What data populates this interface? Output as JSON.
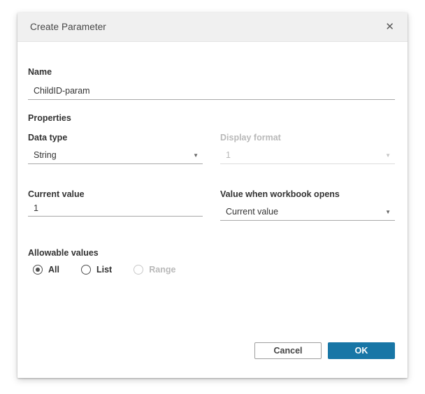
{
  "dialog": {
    "title": "Create Parameter"
  },
  "icons": {
    "close": "✕",
    "dropdown_arrow": "▼"
  },
  "fields": {
    "name": {
      "label": "Name",
      "value": "ChildID-param"
    },
    "properties_heading": "Properties",
    "data_type": {
      "label": "Data type",
      "value": "String"
    },
    "display_format": {
      "label": "Display format",
      "value": "1",
      "disabled": true
    },
    "current_value": {
      "label": "Current value",
      "value": "1"
    },
    "workbook_open_value": {
      "label": "Value when workbook opens",
      "value": "Current value"
    },
    "allowable_values": {
      "label": "Allowable values",
      "options": [
        {
          "label": "All",
          "selected": true,
          "disabled": false
        },
        {
          "label": "List",
          "selected": false,
          "disabled": false
        },
        {
          "label": "Range",
          "selected": false,
          "disabled": true
        }
      ]
    }
  },
  "buttons": {
    "cancel": "Cancel",
    "ok": "OK"
  },
  "colors": {
    "ok_button": "#1876a6",
    "header_bg": "#f0f0f0"
  }
}
